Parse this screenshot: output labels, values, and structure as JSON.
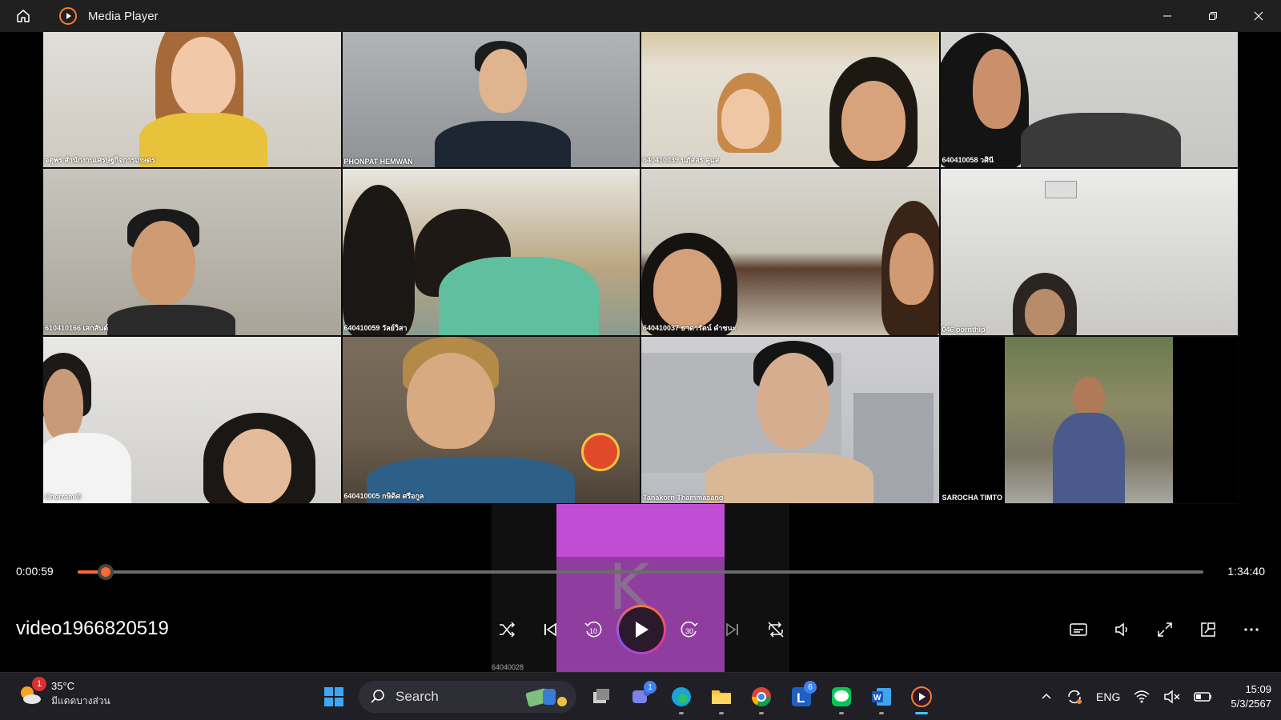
{
  "window": {
    "title": "Media Player"
  },
  "participants": [
    {
      "name": "จตุพร สำนักงานเศรษฐกิจการเกษตร"
    },
    {
      "name": "PHONPAT HEMWAN"
    },
    {
      "name": "640410039 นภัสสร คูแส"
    },
    {
      "name": "640410058 วศินี"
    },
    {
      "name": "610410166 เสกสันต์"
    },
    {
      "name": "640410059 วัลย์วิสา"
    },
    {
      "name": "640410037 ธาดารัตน์ คำชนะ"
    },
    {
      "name": "046 pornthip"
    },
    {
      "name": "Cherram😰"
    },
    {
      "name": "640410005 กษิดิศ ศรีอกูล"
    },
    {
      "name": "Tanakorn Thammasang"
    },
    {
      "name": "SAROCHA TIMTO"
    }
  ],
  "overlay": {
    "letter": "K",
    "code": "64040028"
  },
  "player": {
    "current_time": "0:00:59",
    "total_time": "1:34:40",
    "progress": 0.0104,
    "video_title": "video1966820519",
    "accent": "#ff6a2c"
  },
  "taskbar": {
    "weather": {
      "temp": "35°C",
      "desc": "มีแดดบางส่วน",
      "badge": "1"
    },
    "search_label": "Search",
    "teams_badge": "1",
    "line_badge": "6",
    "language": "ENG",
    "time": "15:09",
    "date": "5/3/2567"
  }
}
